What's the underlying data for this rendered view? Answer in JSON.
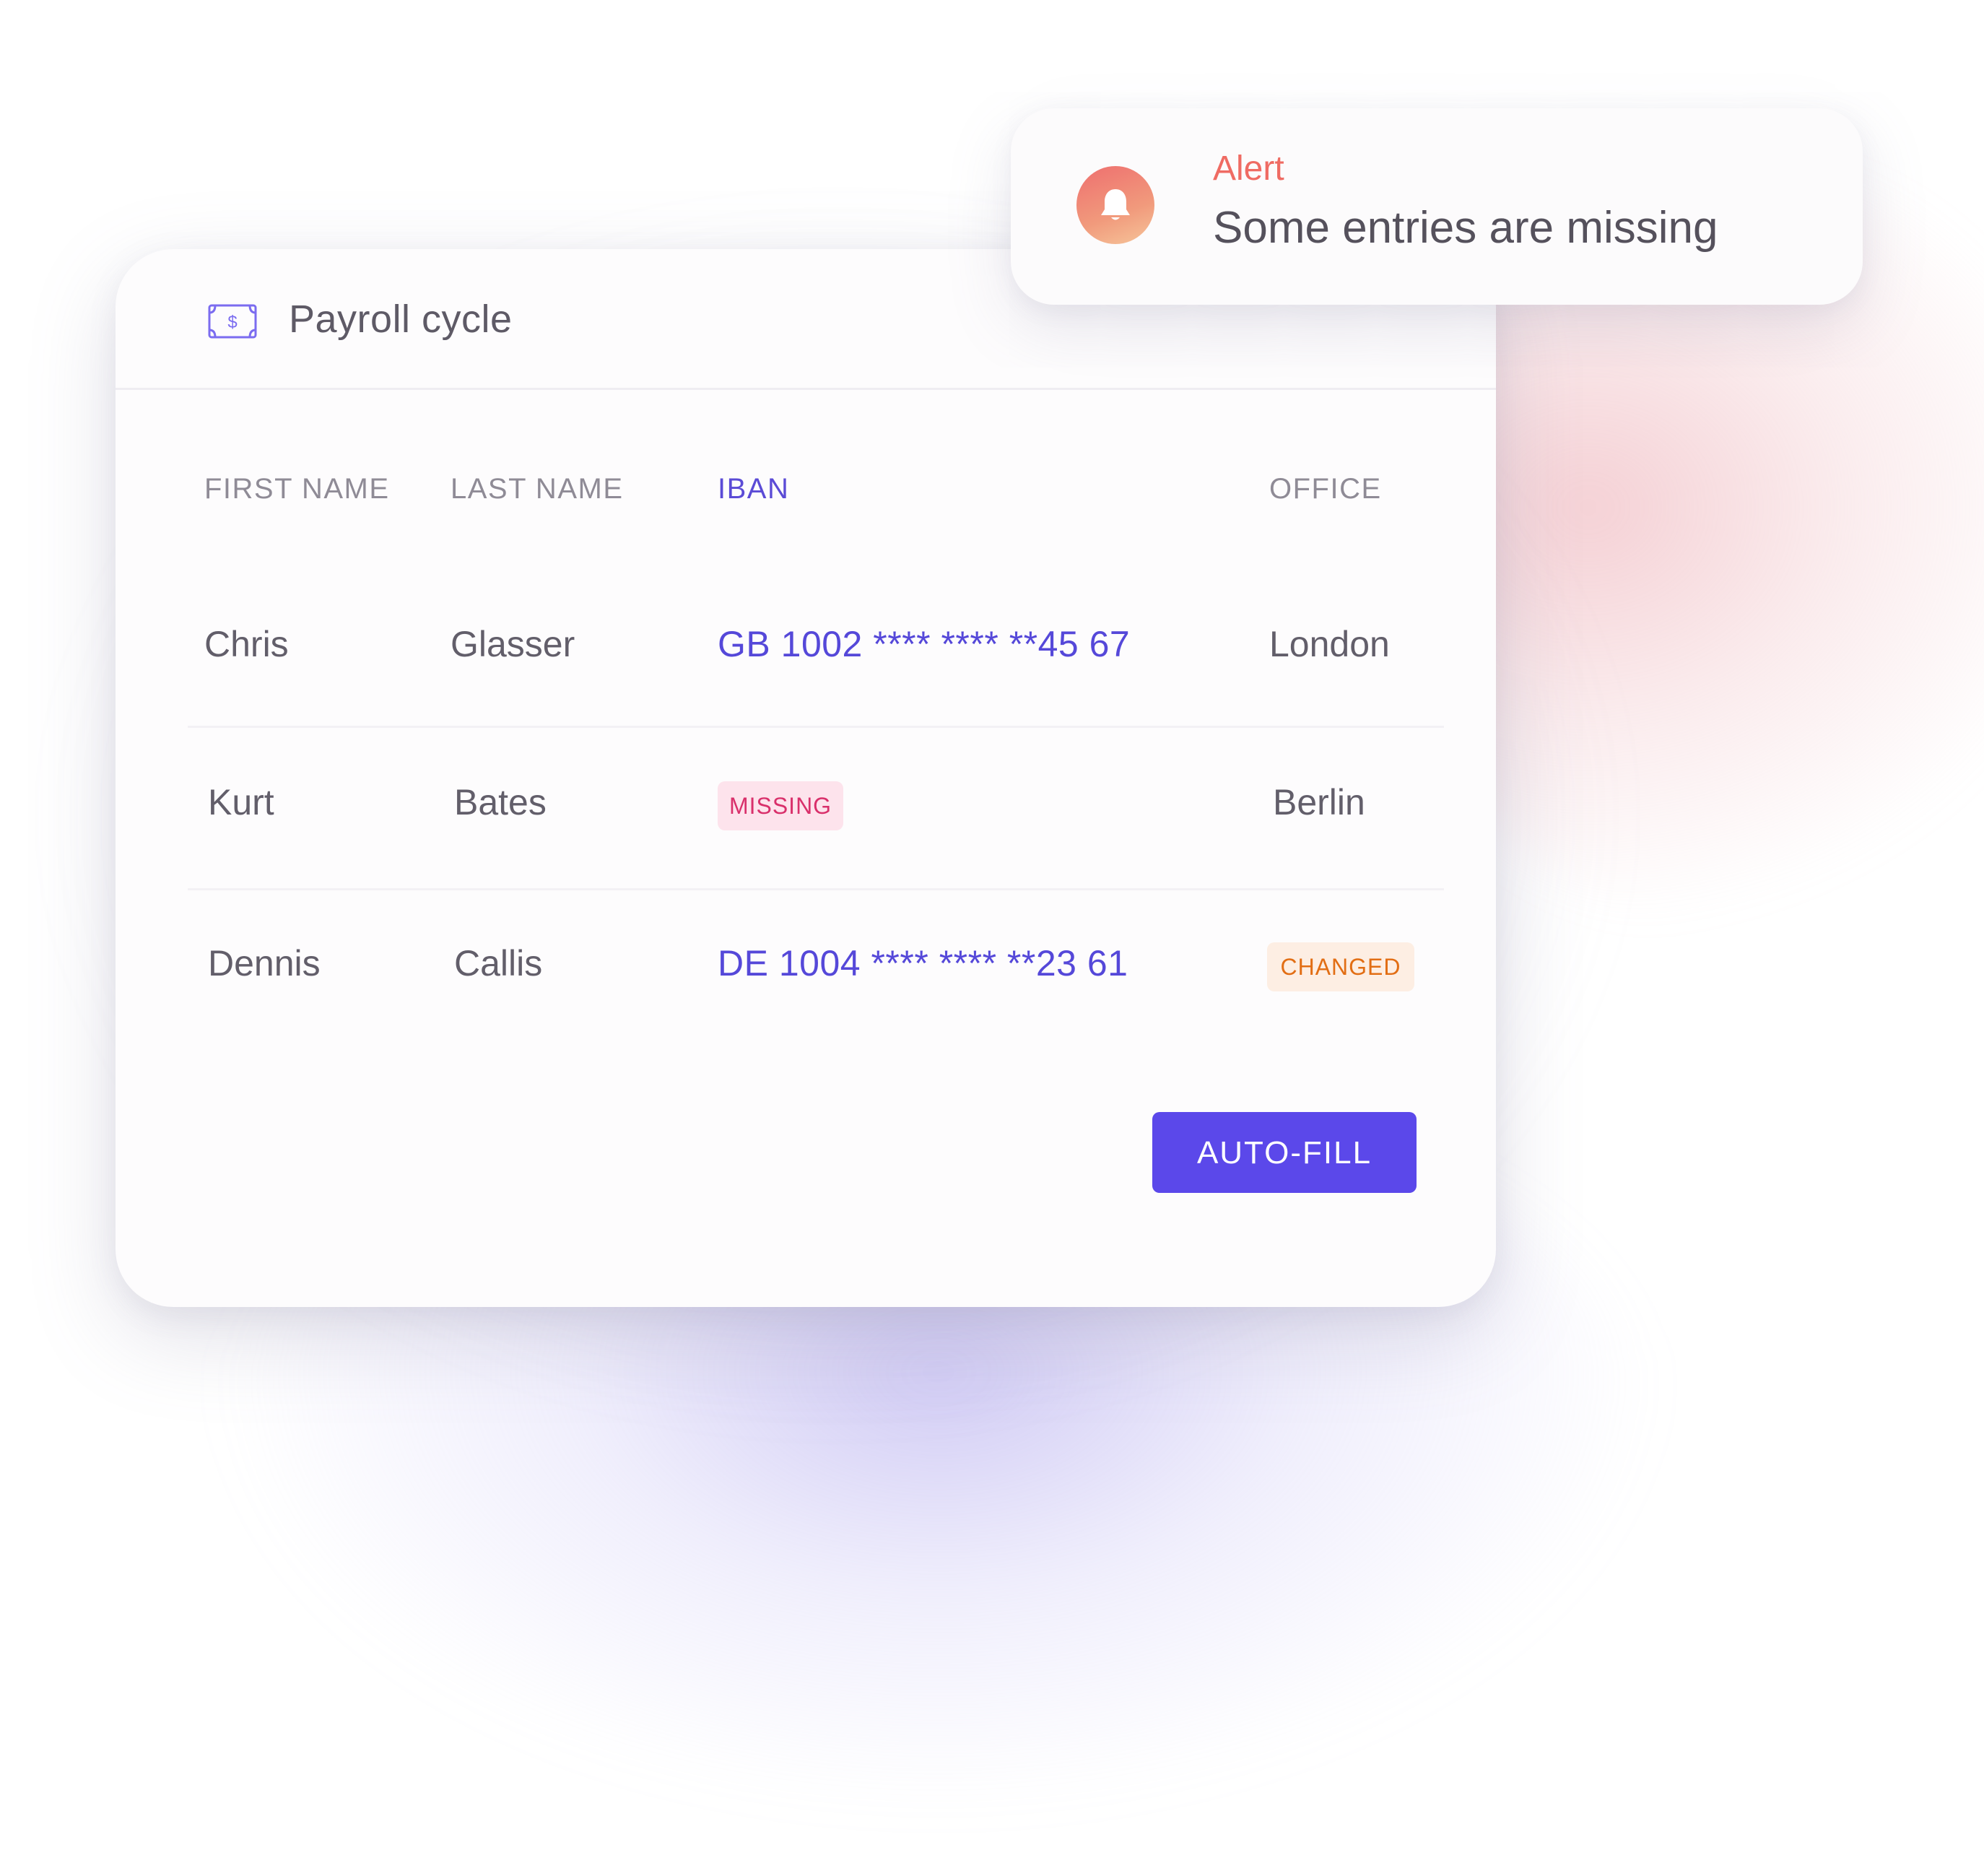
{
  "alert": {
    "label": "Alert",
    "message": "Some entries are missing",
    "icon": "bell-icon"
  },
  "card": {
    "title": "Payroll cycle",
    "icon": "money-icon"
  },
  "table": {
    "columns": [
      "FIRST NAME",
      "LAST NAME",
      "IBAN",
      "OFFICE"
    ],
    "rows": [
      {
        "first_name": "Chris",
        "last_name": "Glasser",
        "iban": "GB 1002 **** **** **45 67",
        "office": "London"
      },
      {
        "first_name": "Kurt",
        "last_name": "Bates",
        "iban_status": "MISSING",
        "office": "Berlin"
      },
      {
        "first_name": "Dennis",
        "last_name": "Callis",
        "iban": "DE 1004 **** **** **23 61",
        "office_status": "CHANGED"
      }
    ]
  },
  "actions": {
    "autofill_label": "AUTO-FILL"
  },
  "colors": {
    "accent": "#5b48ea",
    "iban_text": "#5548d9",
    "alert_label": "#ef6b63",
    "missing_badge_text": "#d9306b",
    "missing_badge_bg": "#fde3ec",
    "changed_badge_text": "#e26e14",
    "changed_badge_bg": "#fdeee3"
  }
}
